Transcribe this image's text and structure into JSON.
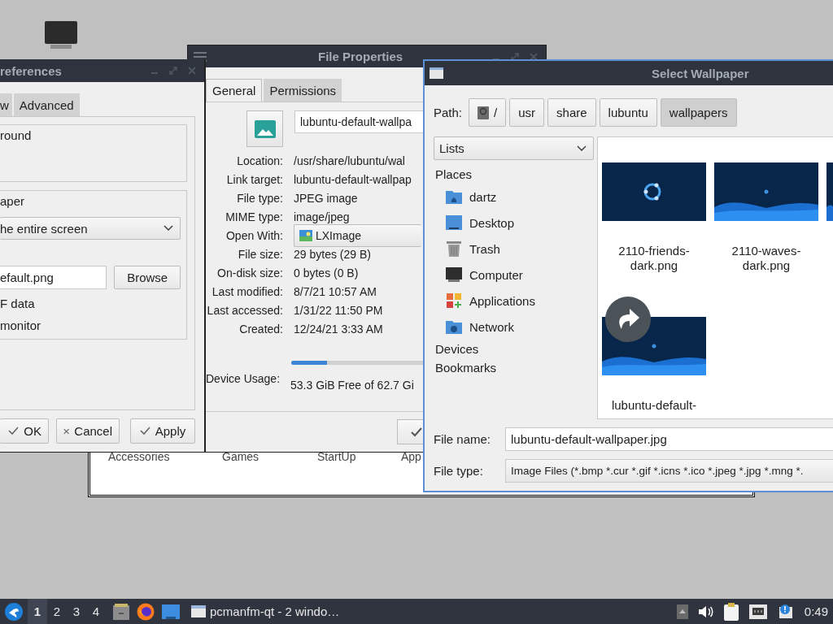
{
  "background_window": {
    "labels": [
      "Accessories",
      "Games",
      "StartUp",
      "App"
    ]
  },
  "preferences": {
    "title": "references",
    "tabs": [
      {
        "label": "w",
        "selected": false
      },
      {
        "label": "Advanced",
        "selected": false
      }
    ],
    "background_group": {
      "title": "round"
    },
    "wallpaper_group": {
      "title": "aper",
      "mode": "he entire screen",
      "file": "efault.png",
      "browse": "Browse",
      "options": [
        "F data",
        "monitor"
      ]
    },
    "buttons": [
      {
        "label": "OK",
        "kind": "check"
      },
      {
        "label": "Cancel",
        "kind": "cross"
      },
      {
        "label": "Apply",
        "kind": "check"
      }
    ]
  },
  "file_properties": {
    "title": "File Properties",
    "tabs": [
      {
        "label": "General",
        "selected": true
      },
      {
        "label": "Permissions",
        "selected": false
      }
    ],
    "name": "lubuntu-default-wallpa",
    "fields": [
      {
        "label": "Location:",
        "value": "/usr/share/lubuntu/wal",
        "kind": "text"
      },
      {
        "label": "Link target:",
        "value": "lubuntu-default-wallpap",
        "kind": "text"
      },
      {
        "label": "File type:",
        "value": "JPEG image",
        "kind": "text"
      },
      {
        "label": "MIME type:",
        "value": "image/jpeg",
        "kind": "text"
      },
      {
        "label": "Open With:",
        "value": "LXImage",
        "kind": "select"
      },
      {
        "label": "File size:",
        "value": "29 bytes (29 B)",
        "kind": "text"
      },
      {
        "label": "On-disk size:",
        "value": "0 bytes (0 B)",
        "kind": "text"
      },
      {
        "label": "Last modified:",
        "value": "8/7/21 10:57 AM",
        "kind": "text"
      },
      {
        "label": "Last accessed:",
        "value": "1/31/22 11:50 PM",
        "kind": "text"
      },
      {
        "label": "Created:",
        "value": "12/24/21 3:33 AM",
        "kind": "text"
      }
    ],
    "device_usage": {
      "label": "Device Usage:",
      "level": 0.15,
      "reading": "53.3 GiB Free of 62.7 Gi"
    }
  },
  "select_wallpaper": {
    "title": "Select Wallpaper",
    "path_label": "Path:",
    "path": [
      {
        "label": "/",
        "kind": "root",
        "selected": false
      },
      {
        "label": "usr",
        "kind": "folder",
        "selected": false
      },
      {
        "label": "share",
        "kind": "folder",
        "selected": false
      },
      {
        "label": "lubuntu",
        "kind": "folder",
        "selected": false
      },
      {
        "label": "wallpapers",
        "kind": "folder",
        "selected": true
      }
    ],
    "view_mode": "Lists",
    "sections": [
      {
        "title": "Places",
        "items": [
          {
            "label": "dartz",
            "kind": "home"
          },
          {
            "label": "Desktop",
            "kind": "desktop"
          },
          {
            "label": "Trash",
            "kind": "trash"
          },
          {
            "label": "Computer",
            "kind": "computer"
          },
          {
            "label": "Applications",
            "kind": "applications"
          },
          {
            "label": "Network",
            "kind": "network"
          }
        ]
      },
      {
        "title": "Devices"
      },
      {
        "title": "Bookmarks"
      }
    ],
    "files": [
      {
        "name": "2110-friends-dark.png",
        "symlink": false
      },
      {
        "name": "2110-waves-dark.png",
        "symlink": false
      },
      {
        "name": "lubuntu-default-",
        "symlink": true
      }
    ],
    "file_name_label": "File name:",
    "file_name": "lubuntu-default-wallpaper.jpg",
    "file_type_label": "File type:",
    "file_type": "Image Files (*.bmp *.cur *.gif *.icns *.ico *.jpeg *.jpg *.mng *."
  },
  "taskbar": {
    "workspaces": [
      {
        "label": "1",
        "selected": true
      },
      {
        "label": "2",
        "selected": false
      },
      {
        "label": "3",
        "selected": false
      },
      {
        "label": "4",
        "selected": false
      }
    ],
    "task": "pcmanfm-qt - 2 windo…",
    "clock": "0:49"
  }
}
